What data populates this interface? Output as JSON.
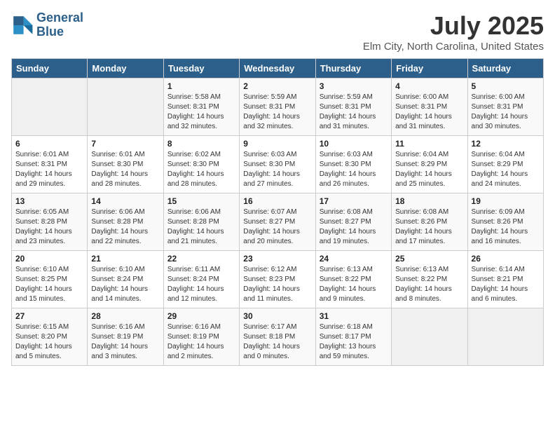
{
  "logo": {
    "line1": "General",
    "line2": "Blue"
  },
  "title": "July 2025",
  "subtitle": "Elm City, North Carolina, United States",
  "days_of_week": [
    "Sunday",
    "Monday",
    "Tuesday",
    "Wednesday",
    "Thursday",
    "Friday",
    "Saturday"
  ],
  "weeks": [
    [
      {
        "day": "",
        "empty": true
      },
      {
        "day": "",
        "empty": true
      },
      {
        "day": "1",
        "sunrise": "Sunrise: 5:58 AM",
        "sunset": "Sunset: 8:31 PM",
        "daylight": "Daylight: 14 hours and 32 minutes."
      },
      {
        "day": "2",
        "sunrise": "Sunrise: 5:59 AM",
        "sunset": "Sunset: 8:31 PM",
        "daylight": "Daylight: 14 hours and 32 minutes."
      },
      {
        "day": "3",
        "sunrise": "Sunrise: 5:59 AM",
        "sunset": "Sunset: 8:31 PM",
        "daylight": "Daylight: 14 hours and 31 minutes."
      },
      {
        "day": "4",
        "sunrise": "Sunrise: 6:00 AM",
        "sunset": "Sunset: 8:31 PM",
        "daylight": "Daylight: 14 hours and 31 minutes."
      },
      {
        "day": "5",
        "sunrise": "Sunrise: 6:00 AM",
        "sunset": "Sunset: 8:31 PM",
        "daylight": "Daylight: 14 hours and 30 minutes."
      }
    ],
    [
      {
        "day": "6",
        "sunrise": "Sunrise: 6:01 AM",
        "sunset": "Sunset: 8:31 PM",
        "daylight": "Daylight: 14 hours and 29 minutes."
      },
      {
        "day": "7",
        "sunrise": "Sunrise: 6:01 AM",
        "sunset": "Sunset: 8:30 PM",
        "daylight": "Daylight: 14 hours and 28 minutes."
      },
      {
        "day": "8",
        "sunrise": "Sunrise: 6:02 AM",
        "sunset": "Sunset: 8:30 PM",
        "daylight": "Daylight: 14 hours and 28 minutes."
      },
      {
        "day": "9",
        "sunrise": "Sunrise: 6:03 AM",
        "sunset": "Sunset: 8:30 PM",
        "daylight": "Daylight: 14 hours and 27 minutes."
      },
      {
        "day": "10",
        "sunrise": "Sunrise: 6:03 AM",
        "sunset": "Sunset: 8:30 PM",
        "daylight": "Daylight: 14 hours and 26 minutes."
      },
      {
        "day": "11",
        "sunrise": "Sunrise: 6:04 AM",
        "sunset": "Sunset: 8:29 PM",
        "daylight": "Daylight: 14 hours and 25 minutes."
      },
      {
        "day": "12",
        "sunrise": "Sunrise: 6:04 AM",
        "sunset": "Sunset: 8:29 PM",
        "daylight": "Daylight: 14 hours and 24 minutes."
      }
    ],
    [
      {
        "day": "13",
        "sunrise": "Sunrise: 6:05 AM",
        "sunset": "Sunset: 8:28 PM",
        "daylight": "Daylight: 14 hours and 23 minutes."
      },
      {
        "day": "14",
        "sunrise": "Sunrise: 6:06 AM",
        "sunset": "Sunset: 8:28 PM",
        "daylight": "Daylight: 14 hours and 22 minutes."
      },
      {
        "day": "15",
        "sunrise": "Sunrise: 6:06 AM",
        "sunset": "Sunset: 8:28 PM",
        "daylight": "Daylight: 14 hours and 21 minutes."
      },
      {
        "day": "16",
        "sunrise": "Sunrise: 6:07 AM",
        "sunset": "Sunset: 8:27 PM",
        "daylight": "Daylight: 14 hours and 20 minutes."
      },
      {
        "day": "17",
        "sunrise": "Sunrise: 6:08 AM",
        "sunset": "Sunset: 8:27 PM",
        "daylight": "Daylight: 14 hours and 19 minutes."
      },
      {
        "day": "18",
        "sunrise": "Sunrise: 6:08 AM",
        "sunset": "Sunset: 8:26 PM",
        "daylight": "Daylight: 14 hours and 17 minutes."
      },
      {
        "day": "19",
        "sunrise": "Sunrise: 6:09 AM",
        "sunset": "Sunset: 8:26 PM",
        "daylight": "Daylight: 14 hours and 16 minutes."
      }
    ],
    [
      {
        "day": "20",
        "sunrise": "Sunrise: 6:10 AM",
        "sunset": "Sunset: 8:25 PM",
        "daylight": "Daylight: 14 hours and 15 minutes."
      },
      {
        "day": "21",
        "sunrise": "Sunrise: 6:10 AM",
        "sunset": "Sunset: 8:24 PM",
        "daylight": "Daylight: 14 hours and 14 minutes."
      },
      {
        "day": "22",
        "sunrise": "Sunrise: 6:11 AM",
        "sunset": "Sunset: 8:24 PM",
        "daylight": "Daylight: 14 hours and 12 minutes."
      },
      {
        "day": "23",
        "sunrise": "Sunrise: 6:12 AM",
        "sunset": "Sunset: 8:23 PM",
        "daylight": "Daylight: 14 hours and 11 minutes."
      },
      {
        "day": "24",
        "sunrise": "Sunrise: 6:13 AM",
        "sunset": "Sunset: 8:22 PM",
        "daylight": "Daylight: 14 hours and 9 minutes."
      },
      {
        "day": "25",
        "sunrise": "Sunrise: 6:13 AM",
        "sunset": "Sunset: 8:22 PM",
        "daylight": "Daylight: 14 hours and 8 minutes."
      },
      {
        "day": "26",
        "sunrise": "Sunrise: 6:14 AM",
        "sunset": "Sunset: 8:21 PM",
        "daylight": "Daylight: 14 hours and 6 minutes."
      }
    ],
    [
      {
        "day": "27",
        "sunrise": "Sunrise: 6:15 AM",
        "sunset": "Sunset: 8:20 PM",
        "daylight": "Daylight: 14 hours and 5 minutes."
      },
      {
        "day": "28",
        "sunrise": "Sunrise: 6:16 AM",
        "sunset": "Sunset: 8:19 PM",
        "daylight": "Daylight: 14 hours and 3 minutes."
      },
      {
        "day": "29",
        "sunrise": "Sunrise: 6:16 AM",
        "sunset": "Sunset: 8:19 PM",
        "daylight": "Daylight: 14 hours and 2 minutes."
      },
      {
        "day": "30",
        "sunrise": "Sunrise: 6:17 AM",
        "sunset": "Sunset: 8:18 PM",
        "daylight": "Daylight: 14 hours and 0 minutes."
      },
      {
        "day": "31",
        "sunrise": "Sunrise: 6:18 AM",
        "sunset": "Sunset: 8:17 PM",
        "daylight": "Daylight: 13 hours and 59 minutes."
      },
      {
        "day": "",
        "empty": true
      },
      {
        "day": "",
        "empty": true
      }
    ]
  ]
}
